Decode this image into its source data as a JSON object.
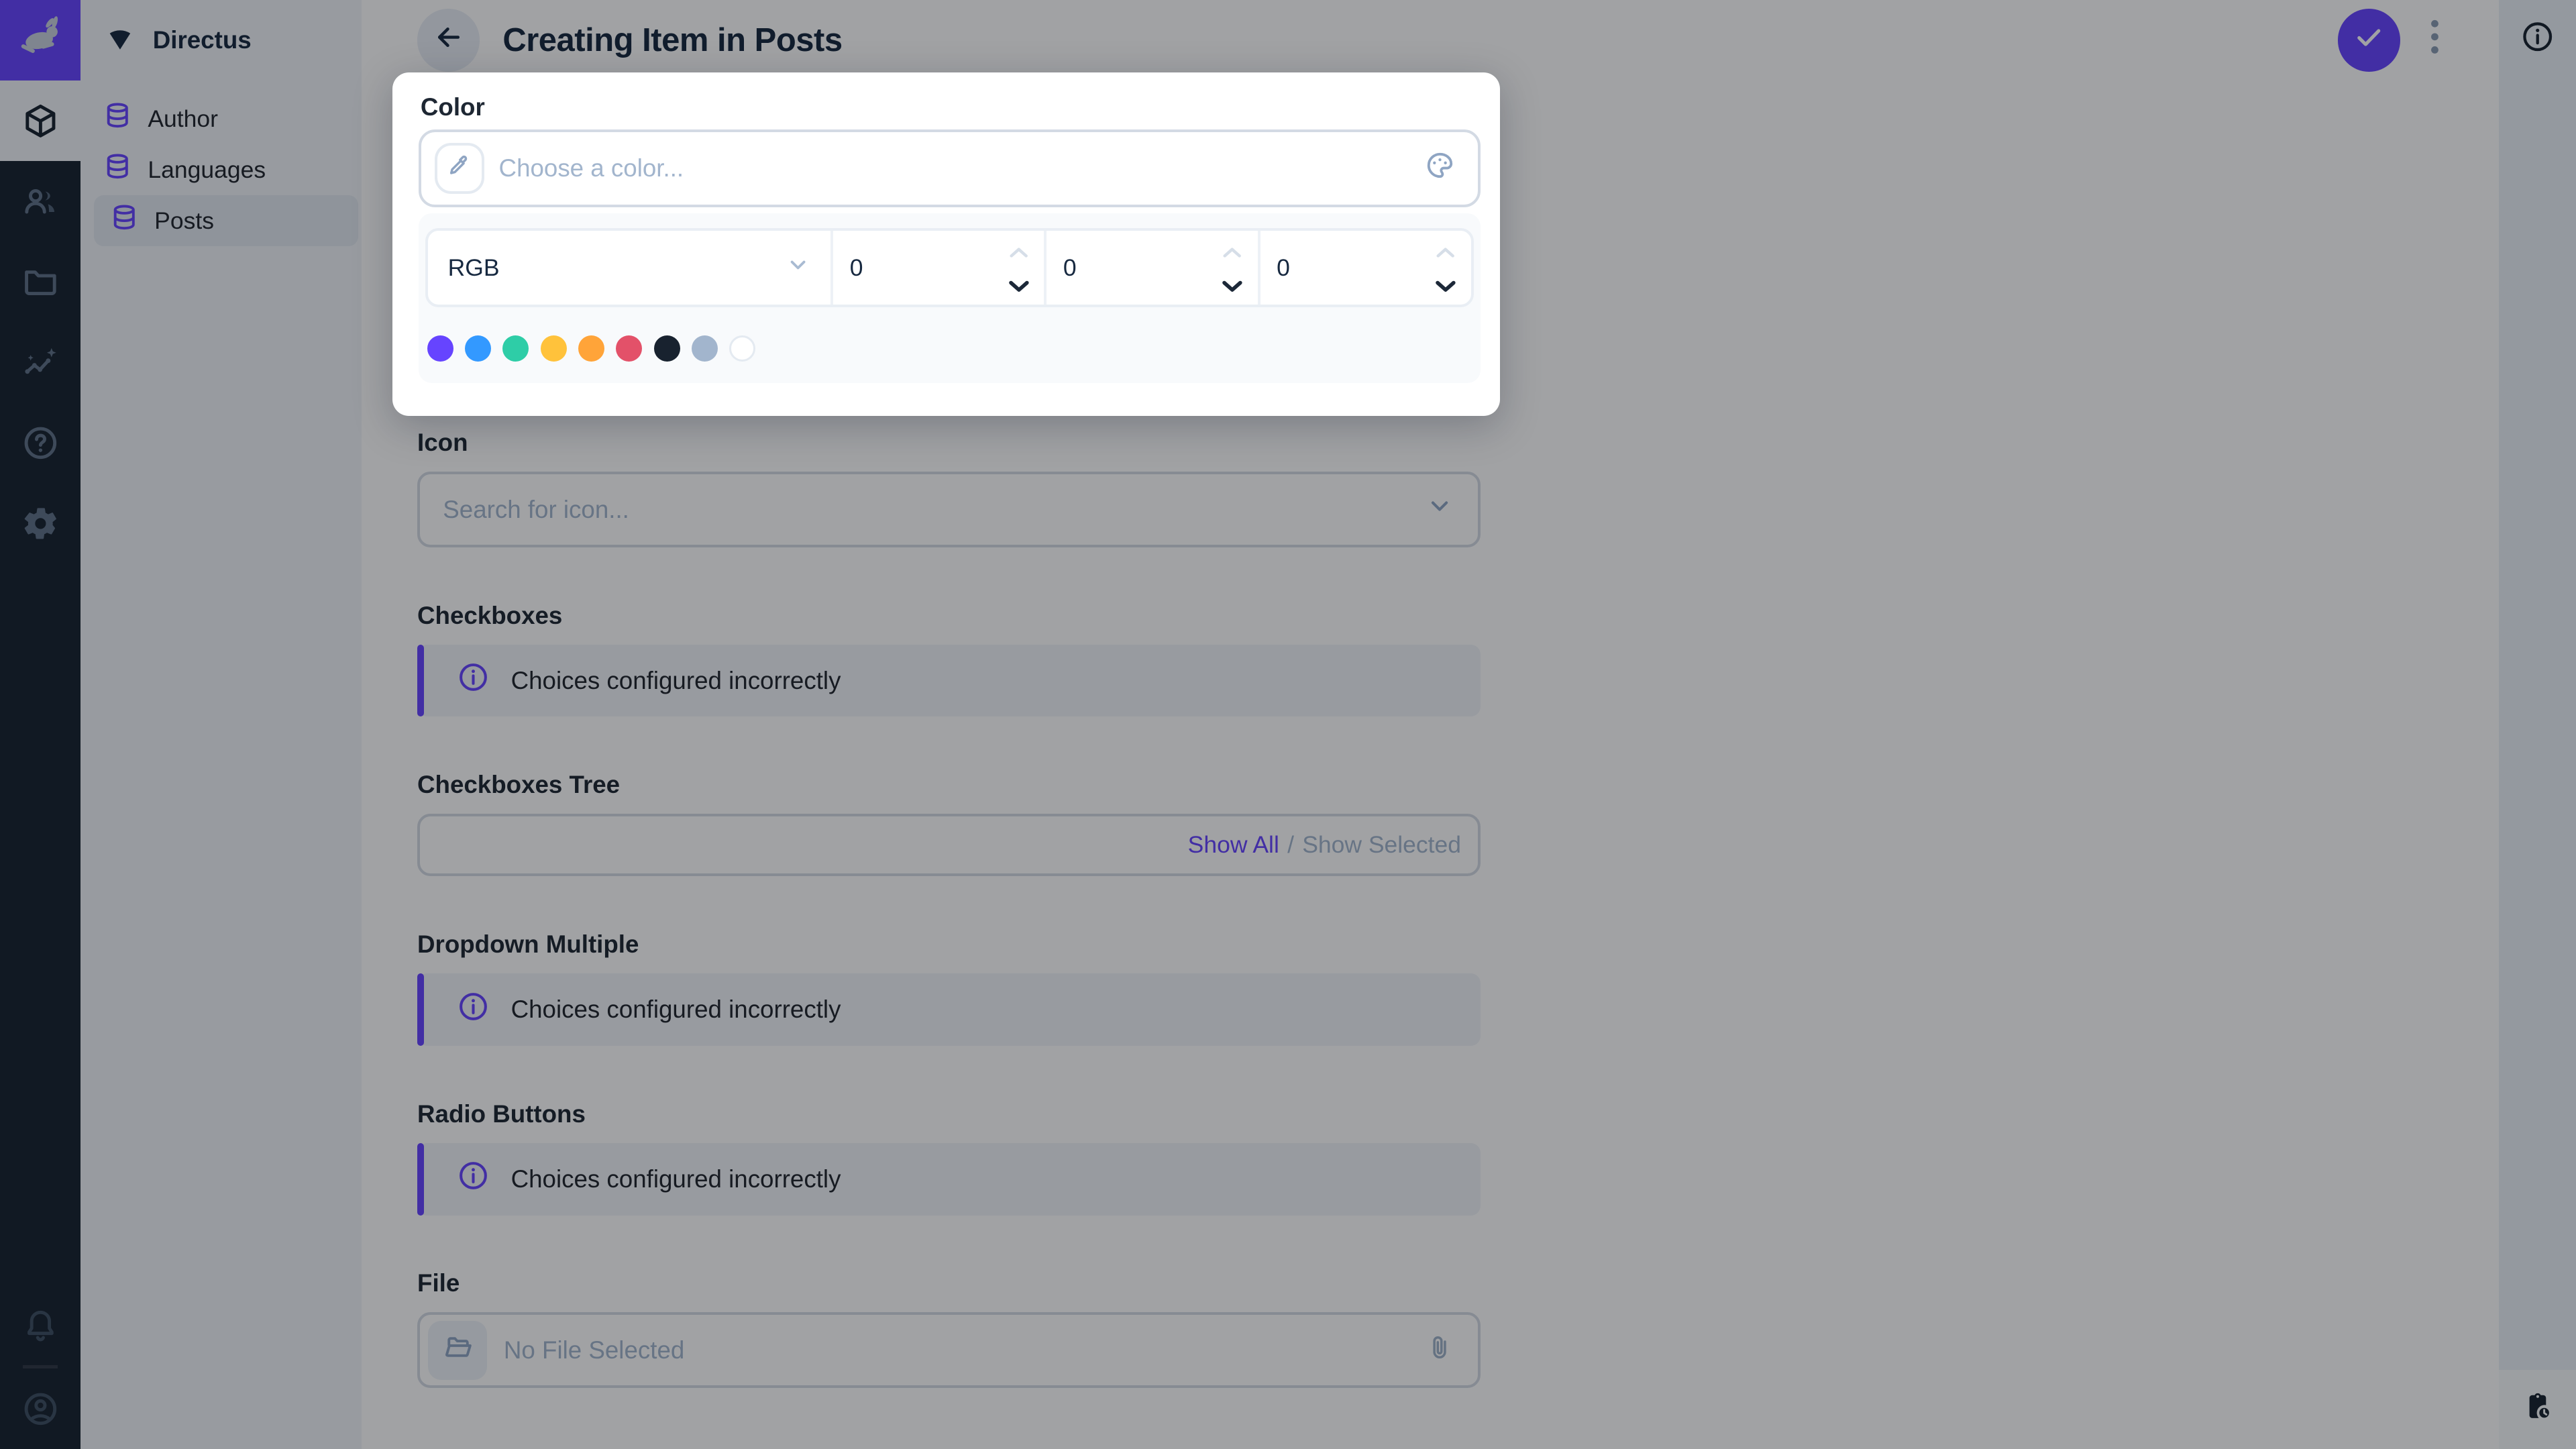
{
  "app": {
    "colors": {
      "primary": "#6644FF",
      "module_bar_bg": "#18222F",
      "sidebar_bg": "#F0F4F9",
      "border": "#D3DAE4",
      "placeholder_text": "#A2B5CD",
      "title_text": "#172940"
    }
  },
  "module_bar": {
    "logo_icon": "directus-rabbit-icon",
    "modules": [
      {
        "icon": "box-icon",
        "name": "content",
        "active": true
      },
      {
        "icon": "people-icon",
        "name": "user-directory",
        "active": false
      },
      {
        "icon": "folder-icon",
        "name": "file-library",
        "active": false
      },
      {
        "icon": "insights-icon",
        "name": "insights",
        "active": false
      },
      {
        "icon": "help-icon",
        "name": "documentation",
        "active": false
      },
      {
        "icon": "gear-icon",
        "name": "settings",
        "active": false
      }
    ],
    "bottom": [
      {
        "icon": "bell-icon",
        "name": "notifications"
      },
      {
        "icon": "account-circle-icon",
        "name": "profile"
      }
    ]
  },
  "nav": {
    "project": {
      "icon": "fan-icon",
      "name": "Directus"
    },
    "items": [
      {
        "icon": "database-icon",
        "label": "Author",
        "active": false
      },
      {
        "icon": "database-icon",
        "label": "Languages",
        "active": false
      },
      {
        "icon": "database-icon",
        "label": "Posts",
        "active": true
      }
    ]
  },
  "header": {
    "title": "Creating Item in Posts",
    "back_icon": "arrow-left-icon",
    "save_icon": "check-icon",
    "menu_icon": "more-vertical-icon"
  },
  "right_sidebar": {
    "top_icon": "info-icon",
    "bottom_icon": "pending-actions-icon"
  },
  "color_popup": {
    "label": "Color",
    "input": {
      "placeholder": "Choose a color...",
      "value": "",
      "left_icon": "eyedropper-icon",
      "right_icon": "palette-icon"
    },
    "mode_select": {
      "value": "RGB"
    },
    "channels": [
      {
        "value": "0"
      },
      {
        "value": "0"
      },
      {
        "value": "0"
      }
    ],
    "presets": [
      "#6644FF",
      "#3399FF",
      "#2ECDA7",
      "#FFC23B",
      "#FFA439",
      "#E35169",
      "#18222F",
      "#A2B5CD",
      "#FFFFFF"
    ]
  },
  "fields": {
    "icon": {
      "label": "Icon",
      "placeholder": "Search for icon...",
      "value": ""
    },
    "checkboxes": {
      "label": "Checkboxes",
      "notice": "Choices configured incorrectly"
    },
    "checkboxes_tree": {
      "label": "Checkboxes Tree",
      "show_all": "Show All",
      "separator": "/",
      "show_selected": "Show Selected"
    },
    "dropdown_multiple": {
      "label": "Dropdown Multiple",
      "notice": "Choices configured incorrectly"
    },
    "radio_buttons": {
      "label": "Radio Buttons",
      "notice": "Choices configured incorrectly"
    },
    "file": {
      "label": "File",
      "placeholder": "No File Selected",
      "left_icon": "folder-open-icon",
      "right_icon": "paperclip-icon"
    }
  }
}
